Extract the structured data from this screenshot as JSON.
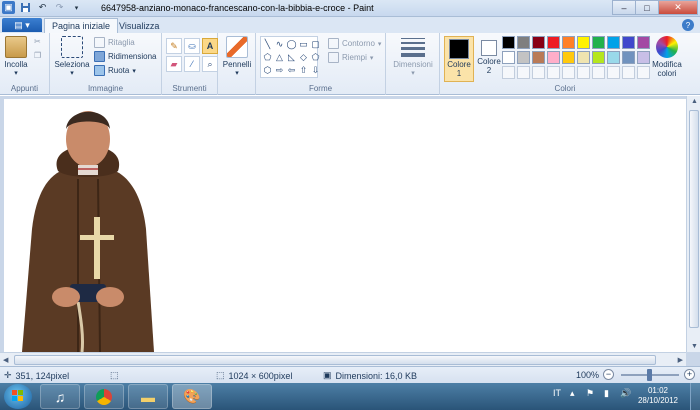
{
  "title_bar": {
    "title": "6647958-anziano-monaco-francescano-con-la-bibbia-e-croce - Paint",
    "quick_access": [
      "paint-app-icon",
      "save-icon",
      "undo-icon",
      "redo-icon",
      "customize-qat-icon"
    ],
    "window_buttons": {
      "minimize": "–",
      "maximize": "□",
      "close": "✕"
    }
  },
  "tabs": {
    "file_icon": "paint-menu-icon",
    "items": [
      {
        "label": "Pagina iniziale",
        "active": true
      },
      {
        "label": "Visualizza",
        "active": false
      }
    ]
  },
  "ribbon": {
    "appunti": {
      "label": "Appunti",
      "paste": "Incolla"
    },
    "immagine": {
      "label": "Immagine",
      "select": "Seleziona",
      "crop": "Ritaglia",
      "resize": "Ridimensiona",
      "rotate": "Ruota"
    },
    "strumenti": {
      "label": "Strumenti"
    },
    "pennelli": {
      "label": "Pennelli"
    },
    "forme": {
      "label": "Forme",
      "outline": "Contorno",
      "fill": "Riempi"
    },
    "dimensioni": {
      "label": "Dimensioni"
    },
    "colori": {
      "label": "Colori",
      "color1": "Colore 1",
      "color2": "Colore 2",
      "edit": "Modifica colori",
      "color1_value": "#000000",
      "color2_value": "#ffffff",
      "palette": [
        "#000000",
        "#7f7f7f",
        "#880015",
        "#ed1c24",
        "#ff7f27",
        "#fff200",
        "#22b14c",
        "#00a2e8",
        "#3f48cc",
        "#a349a4",
        "#ffffff",
        "#c3c3c3",
        "#b97a57",
        "#ffaec9",
        "#ffc90e",
        "#efe4b0",
        "#b5e61d",
        "#99d9ea",
        "#7092be",
        "#c8bfe7"
      ]
    }
  },
  "status_bar": {
    "cursor_pos": "351, 124pixel",
    "image_size": "1024 × 600pixel",
    "file_size": "Dimensioni: 16,0 KB",
    "zoom": "100%"
  },
  "taskbar": {
    "language": "IT",
    "time": "01:02",
    "date": "28/10/2012"
  }
}
